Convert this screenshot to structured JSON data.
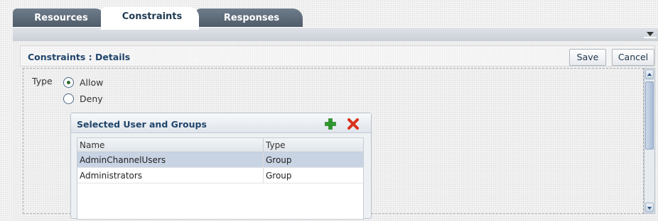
{
  "tabs": [
    {
      "label": "Resources",
      "active": false
    },
    {
      "label": "Constraints",
      "active": true
    },
    {
      "label": "Responses",
      "active": false
    }
  ],
  "panel": {
    "title": "Constraints : Details",
    "save_label": "Save",
    "cancel_label": "Cancel"
  },
  "type_field": {
    "label": "Type",
    "options": [
      {
        "label": "Allow",
        "selected": true
      },
      {
        "label": "Deny",
        "selected": false
      }
    ]
  },
  "groups": {
    "title": "Selected User and Groups",
    "add_icon": "add-icon",
    "delete_icon": "delete-icon",
    "columns": [
      "Name",
      "Type"
    ],
    "rows": [
      {
        "name": "AdminChannelUsers",
        "type": "Group",
        "selected": true
      },
      {
        "name": "Administrators",
        "type": "Group",
        "selected": false
      }
    ]
  },
  "colors": {
    "tab_dark": "#5a6674",
    "title_blue": "#21456b",
    "selected_row": "#c8d3e3",
    "add_green": "#2e9b2e",
    "delete_red": "#d8321c"
  }
}
